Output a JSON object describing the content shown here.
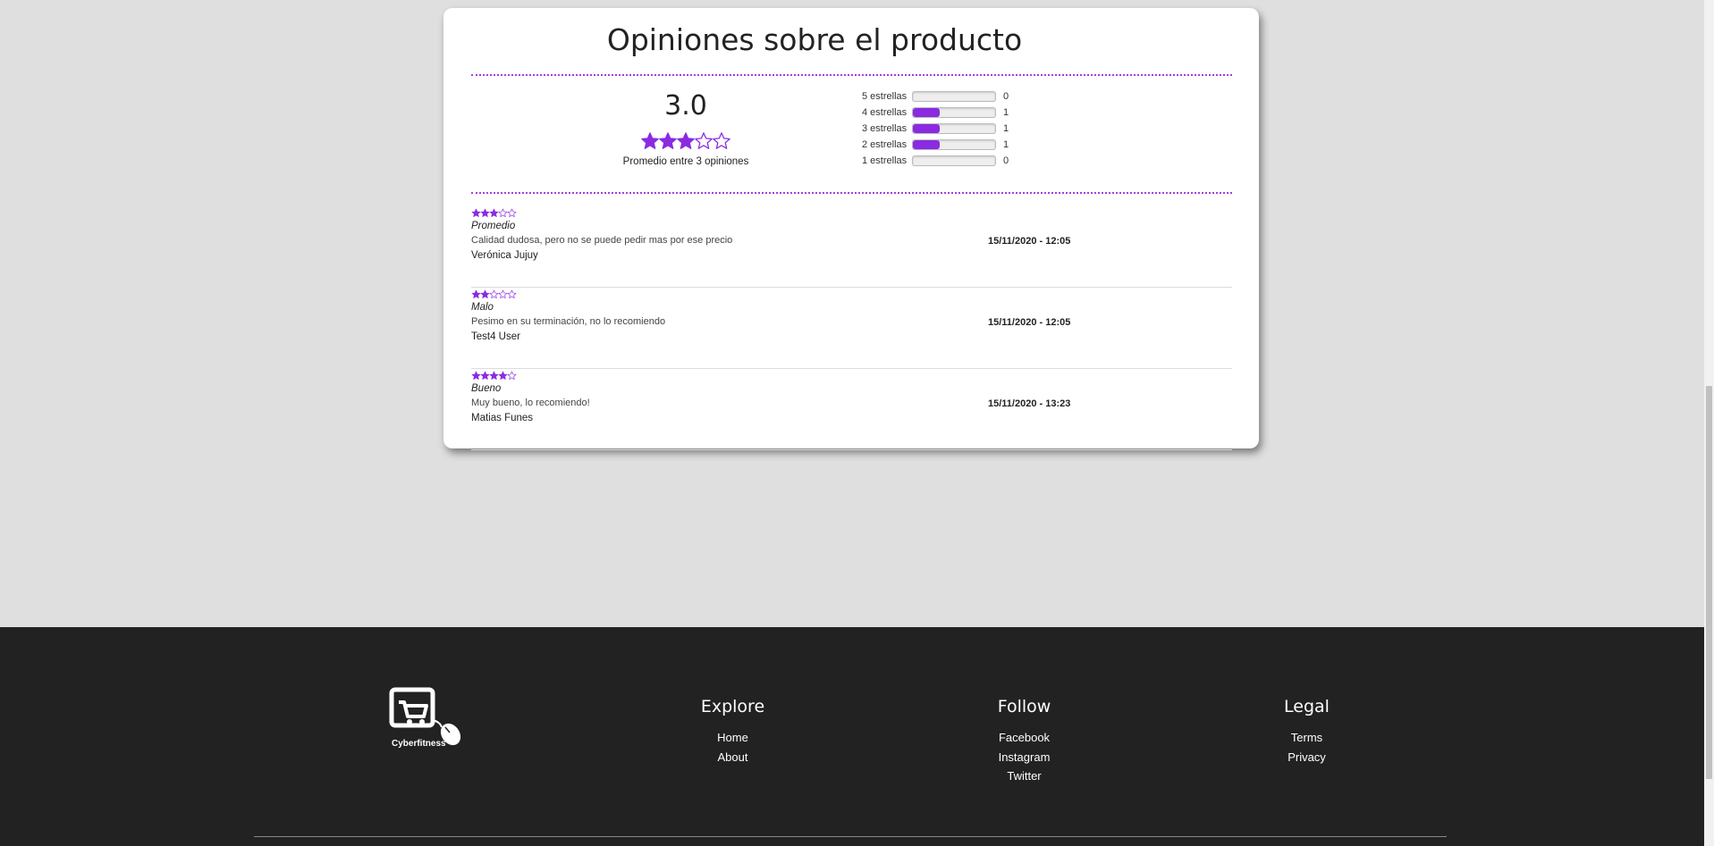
{
  "reviews_section": {
    "title": "Opiniones sobre el producto",
    "average": "3.0",
    "average_stars": 3,
    "average_caption": "Promedio entre 3 opiniones",
    "distribution": [
      {
        "label": "5 estrellas",
        "count": "0",
        "fraction": 0
      },
      {
        "label": "4 estrellas",
        "count": "1",
        "fraction": 0.33
      },
      {
        "label": "3 estrellas",
        "count": "1",
        "fraction": 0.33
      },
      {
        "label": "2 estrellas",
        "count": "1",
        "fraction": 0.33
      },
      {
        "label": "1 estrellas",
        "count": "0",
        "fraction": 0
      }
    ],
    "items": [
      {
        "stars": 3,
        "title": "Promedio",
        "text": "Calidad dudosa, pero no se puede pedir mas por ese precio",
        "user": "Verónica Jujuy",
        "date": "15/11/2020 - 12:05"
      },
      {
        "stars": 2,
        "title": "Malo",
        "text": "Pesimo en su terminación, no lo recomiendo",
        "user": "Test4 User",
        "date": "15/11/2020 - 12:05"
      },
      {
        "stars": 4,
        "title": "Bueno",
        "text": "Muy bueno, lo recomiendo!",
        "user": "Matias Funes",
        "date": "15/11/2020 - 13:23"
      }
    ]
  },
  "footer": {
    "brand": "Cyberfitness",
    "columns": [
      {
        "heading": "Explore",
        "links": [
          "Home",
          "About"
        ]
      },
      {
        "heading": "Follow",
        "links": [
          "Facebook",
          "Instagram",
          "Twitter"
        ]
      },
      {
        "heading": "Legal",
        "links": [
          "Terms",
          "Privacy"
        ]
      }
    ]
  },
  "colors": {
    "accent": "#8a2be2",
    "footer_bg": "#222222",
    "page_bg": "#dfdfdf"
  },
  "icons": {
    "star_filled": "star-filled-icon",
    "star_empty": "star-empty-icon",
    "logo": "cart-mouse-logo-icon"
  }
}
